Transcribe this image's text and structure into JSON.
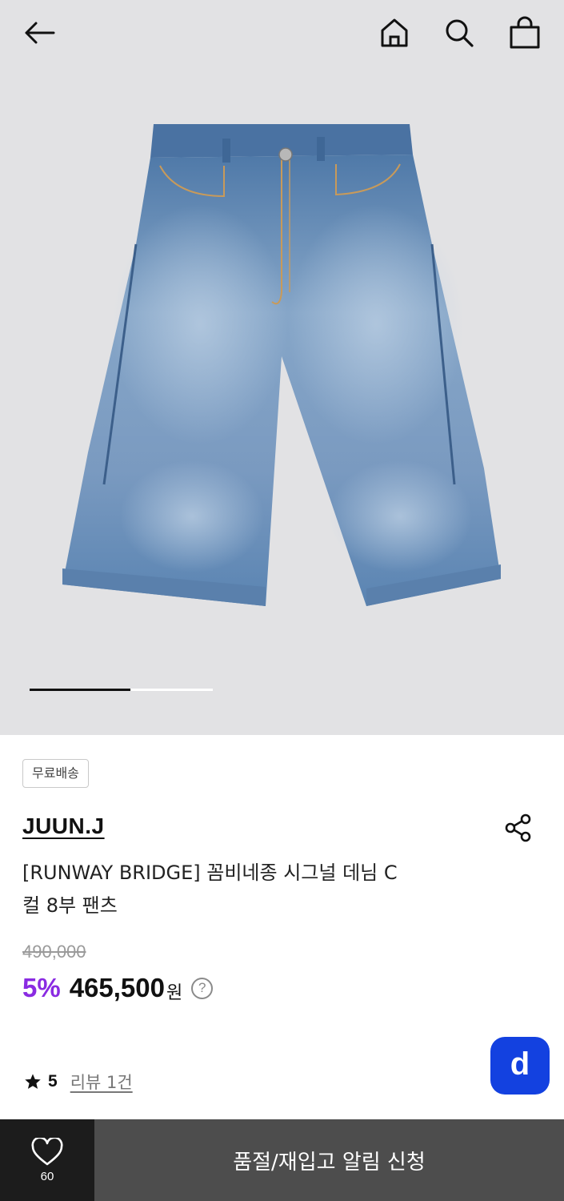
{
  "nav": {
    "back_icon": "arrow-left-icon",
    "home_icon": "home-icon",
    "search_icon": "search-icon",
    "bag_icon": "shopping-bag-icon"
  },
  "gallery": {
    "image_alt": "denim wide bermuda shorts",
    "progress": 0.55
  },
  "product": {
    "badge": "무료배송",
    "brand": "JUUN.J",
    "title_line1": "[RUNWAY BRIDGE] 꼼비네종 시그널 데님 C",
    "title_line2": "컬 8부 팬츠",
    "original_price": "490,000",
    "discount": "5%",
    "price": "465,500",
    "currency": "원",
    "help": "?"
  },
  "rating": {
    "score": "5",
    "review_link": "리뷰 1건"
  },
  "fab": {
    "label": "d"
  },
  "bottom": {
    "like_count": "60",
    "notify_label": "품절/재입고 알림 신청"
  },
  "colors": {
    "discount": "#8a2be2",
    "fab": "#1341e0",
    "hero_bg": "#e2e2e4"
  }
}
